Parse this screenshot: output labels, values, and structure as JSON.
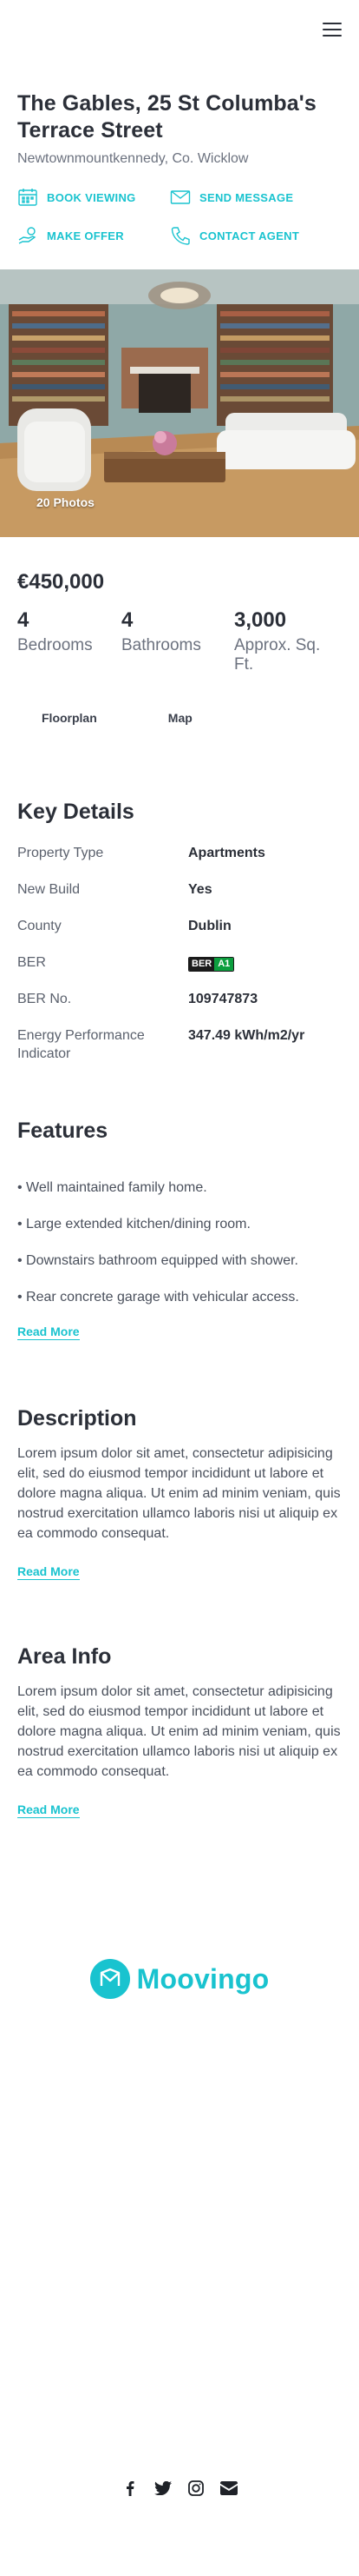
{
  "header": {
    "menu_icon": "hamburger-menu-icon"
  },
  "property": {
    "title": "The Gables, 25 St Columba's Terrace Street",
    "location": "Newtownmountkennedy, Co. Wicklow",
    "price": "€450,000",
    "photo_count": "20 Photos"
  },
  "actions": {
    "book_viewing": "BOOK VIEWING",
    "send_message": "SEND MESSAGE",
    "make_offer": "MAKE OFFER",
    "contact_agent": "CONTACT AGENT"
  },
  "stats": [
    {
      "value": "4",
      "label": "Bedrooms"
    },
    {
      "value": "4",
      "label": "Bathrooms"
    },
    {
      "value": "3,000",
      "label": "Approx. Sq. Ft."
    }
  ],
  "tabs": {
    "floorplan": "Floorplan",
    "map": "Map"
  },
  "key_details": {
    "heading": "Key Details",
    "rows": [
      {
        "key": "Property Type",
        "value": "Apartments"
      },
      {
        "key": "New Build",
        "value": "Yes"
      },
      {
        "key": "County",
        "value": "Dublin"
      },
      {
        "key": "BER",
        "value": ""
      },
      {
        "key": "BER No.",
        "value": "109747873"
      },
      {
        "key": "Energy Performance Indicator",
        "value": "347.49 kWh/m2/yr"
      }
    ],
    "ber_badge": {
      "label": "BER",
      "rating": "A1",
      "color": "#0b9e3e"
    }
  },
  "features": {
    "heading": "Features",
    "items": [
      "• Well maintained family home.",
      "• Large extended kitchen/dining room.",
      "• Downstairs bathroom equipped with shower.",
      "• Rear concrete garage with vehicular access."
    ],
    "read_more": "Read More"
  },
  "description": {
    "heading": "Description",
    "text": "Lorem ipsum dolor sit amet, consectetur adipisicing elit, sed do eiusmod tempor incididunt ut labore et dolore magna aliqua. Ut enim ad minim veniam, quis nostrud exercitation ullamco laboris nisi ut aliquip ex ea commodo consequat.",
    "read_more": "Read More"
  },
  "area_info": {
    "heading": "Area Info",
    "text": "Lorem ipsum dolor sit amet, consectetur adipisicing elit, sed do eiusmod tempor incididunt ut labore et dolore magna aliqua. Ut enim ad minim veniam, quis nostrud exercitation ullamco laboris nisi ut aliquip ex ea commodo consequat.",
    "read_more": "Read More"
  },
  "footer": {
    "brand": "Moovingo",
    "social_icons": [
      "facebook-icon",
      "twitter-icon",
      "instagram-icon",
      "email-icon"
    ]
  },
  "colors": {
    "accent": "#19c3cf",
    "heading": "#2b2f38",
    "body": "#4a505c"
  }
}
